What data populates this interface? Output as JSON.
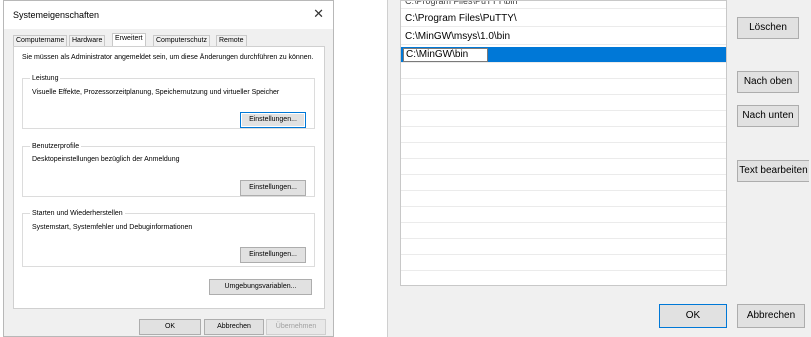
{
  "system_dialog": {
    "title": "Systemeigenschaften",
    "close_icon": "close-icon",
    "tabs": [
      {
        "label": "Computername"
      },
      {
        "label": "Hardware"
      },
      {
        "label": "Erweitert",
        "active": true
      },
      {
        "label": "Computerschutz"
      },
      {
        "label": "Remote"
      }
    ],
    "admin_note": "Sie müssen als Administrator angemeldet sein, um diese Änderungen durchführen zu können.",
    "performance": {
      "title": "Leistung",
      "description": "Visuelle Effekte, Prozessorzeitplanung, Speichernutzung und virtueller Speicher",
      "button": "Einstellungen..."
    },
    "user_profiles": {
      "title": "Benutzerprofile",
      "description": "Desktopeinstellungen bezüglich der Anmeldung",
      "button": "Einstellungen..."
    },
    "startup_recovery": {
      "title": "Starten und Wiederherstellen",
      "description": "Systemstart, Systemfehler und Debuginformationen",
      "button": "Einstellungen..."
    },
    "env_vars_button": "Umgebungsvariablen...",
    "ok_button": "OK",
    "cancel_button": "Abbrechen",
    "apply_button": "Übernehmen"
  },
  "path_editor": {
    "rows": [
      {
        "value": "C:\\Program Files\\PuTTY\\"
      },
      {
        "value": "C:\\MinGW\\msys\\1.0\\bin"
      },
      {
        "value": "C:\\MinGW\\bin",
        "selected": true,
        "editing": true
      }
    ],
    "buttons": {
      "delete": "Löschen",
      "move_up": "Nach oben",
      "move_down": "Nach unten",
      "edit_text": "Text bearbeiten"
    },
    "ok_button": "OK",
    "cancel_button": "Abbrechen",
    "accent_color": "#0078d7"
  }
}
